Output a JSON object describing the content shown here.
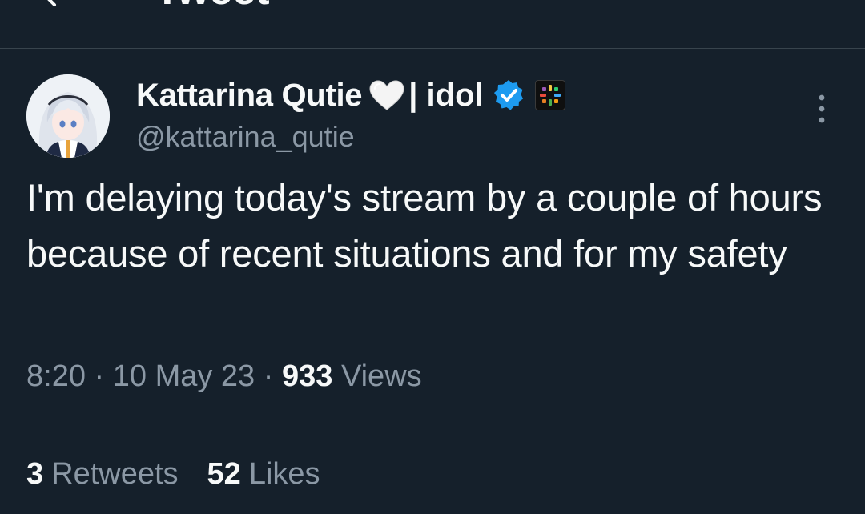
{
  "header": {
    "title": "Tweet",
    "back_icon": "arrow-left-icon"
  },
  "tweet": {
    "author": {
      "name": "Kattarina Qutie",
      "name_suffix": "| idol",
      "handle": "@kattarina_qutie",
      "icons": [
        "white-heart-icon",
        "verified-badge-icon",
        "affiliate-badge-icon"
      ]
    },
    "text": "I'm delaying today's stream by a couple of hours because of recent situations and for my safety",
    "time": "8:20",
    "separator": "·",
    "date": "10 May 23",
    "views_count": "933",
    "views_label": "Views",
    "retweets_count": "3",
    "retweets_label": "Retweets",
    "likes_count": "52",
    "likes_label": "Likes"
  },
  "colors": {
    "background": "#15202b",
    "text_primary": "#f7f9f9",
    "text_secondary": "#8b98a5",
    "divider": "#38444d",
    "verified": "#1d9bf0"
  }
}
